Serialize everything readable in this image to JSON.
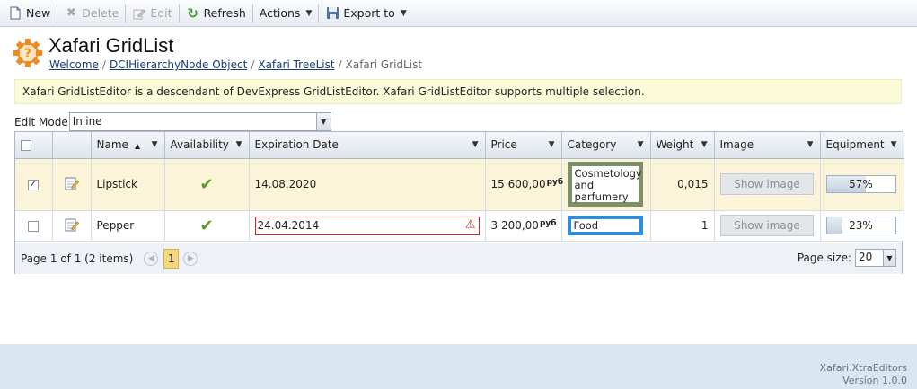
{
  "toolbar": {
    "new_label": "New",
    "delete_label": "Delete",
    "edit_label": "Edit",
    "refresh_label": "Refresh",
    "actions_label": "Actions",
    "export_label": "Export to"
  },
  "header": {
    "title": "Xafari GridList",
    "breadcrumb": [
      "Welcome",
      "DCIHierarchyNode Object",
      "Xafari TreeList",
      "Xafari GridList"
    ],
    "breadcrumb_separator": "/"
  },
  "info_text": "Xafari GridListEditor is a descendant of DevExpress GridListEditor. Xafari GridListEditor supports multiple selection.",
  "edit_mode": {
    "label": "Edit Mode",
    "value": "Inline"
  },
  "grid": {
    "columns": {
      "name": "Name",
      "availability": "Availability",
      "expiration": "Expiration Date",
      "price": "Price",
      "category": "Category",
      "weight": "Weight",
      "image": "Image",
      "equipment": "Equipment"
    },
    "rows": [
      {
        "selected": true,
        "name": "Lipstick",
        "available": true,
        "expiration": "14.08.2020",
        "price": "15 600,00",
        "currency": "руб",
        "category": "Cosmetology and parfumery",
        "weight": "0,015",
        "image_button": "Show image",
        "equipment_pct": 57,
        "equipment_label": "57%"
      },
      {
        "selected": false,
        "name": "Pepper",
        "available": true,
        "expiration": "24.04.2014",
        "price": "3 200,00",
        "currency": "руб",
        "category": "Food",
        "weight": "1",
        "image_button": "Show image",
        "equipment_pct": 23,
        "equipment_label": "23%"
      }
    ],
    "pager": {
      "summary": "Page 1 of 1 (2 items)",
      "current_page": "1",
      "page_size_label": "Page size:",
      "page_size": "20"
    }
  },
  "footer": {
    "product": "Xafari.XtraEditors",
    "version": "Version 1.0.0"
  },
  "colors": {
    "accent": "#f7d77c",
    "selected_row": "#fbf4d8",
    "info_bg": "#fbfbd9",
    "error": "#c9262a",
    "category1_border": "#7f8f68",
    "category2_border": "#2e8ddf"
  }
}
